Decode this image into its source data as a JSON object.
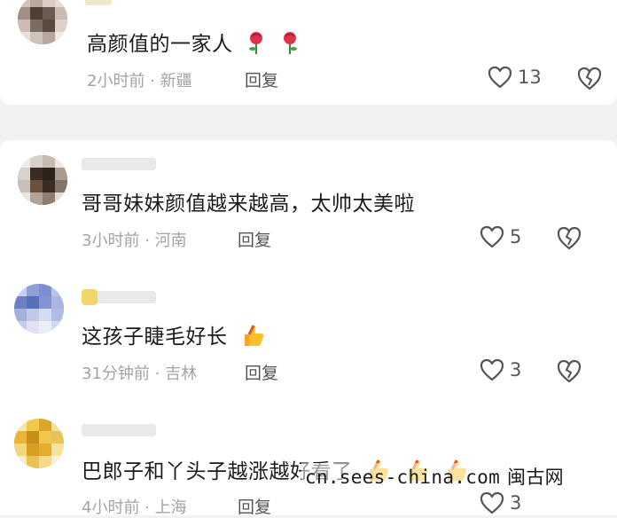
{
  "comments": [
    {
      "text": "高颜值的一家人",
      "emoji": [
        "rose",
        "rose"
      ],
      "time_location": "2小时前 · 新疆",
      "reply_label": "回复",
      "likes": "13"
    },
    {
      "text": "哥哥妹妹颜值越来越高，太帅太美啦",
      "emoji": [],
      "time_location": "3小时前 · 河南",
      "reply_label": "回复",
      "likes": "5"
    },
    {
      "text": "这孩子睫毛好长",
      "emoji": [
        "thumbs-up"
      ],
      "time_location": "31分钟前 · 吉林",
      "reply_label": "回复",
      "likes": "3"
    },
    {
      "text": "巴郎子和丫头子越涨越好看了",
      "emoji": [
        "thumbs-up",
        "thumbs-up",
        "thumbs-up"
      ],
      "time_location": "4小时前 · 上海",
      "reply_label": "回复",
      "likes": "3"
    }
  ],
  "watermark": {
    "url": "cn.sees-china.com",
    "site": "闽古网"
  },
  "colors": {
    "like_icon": "#555555",
    "meta_text": "#a3a3a3",
    "background": "#f2f2f2"
  }
}
